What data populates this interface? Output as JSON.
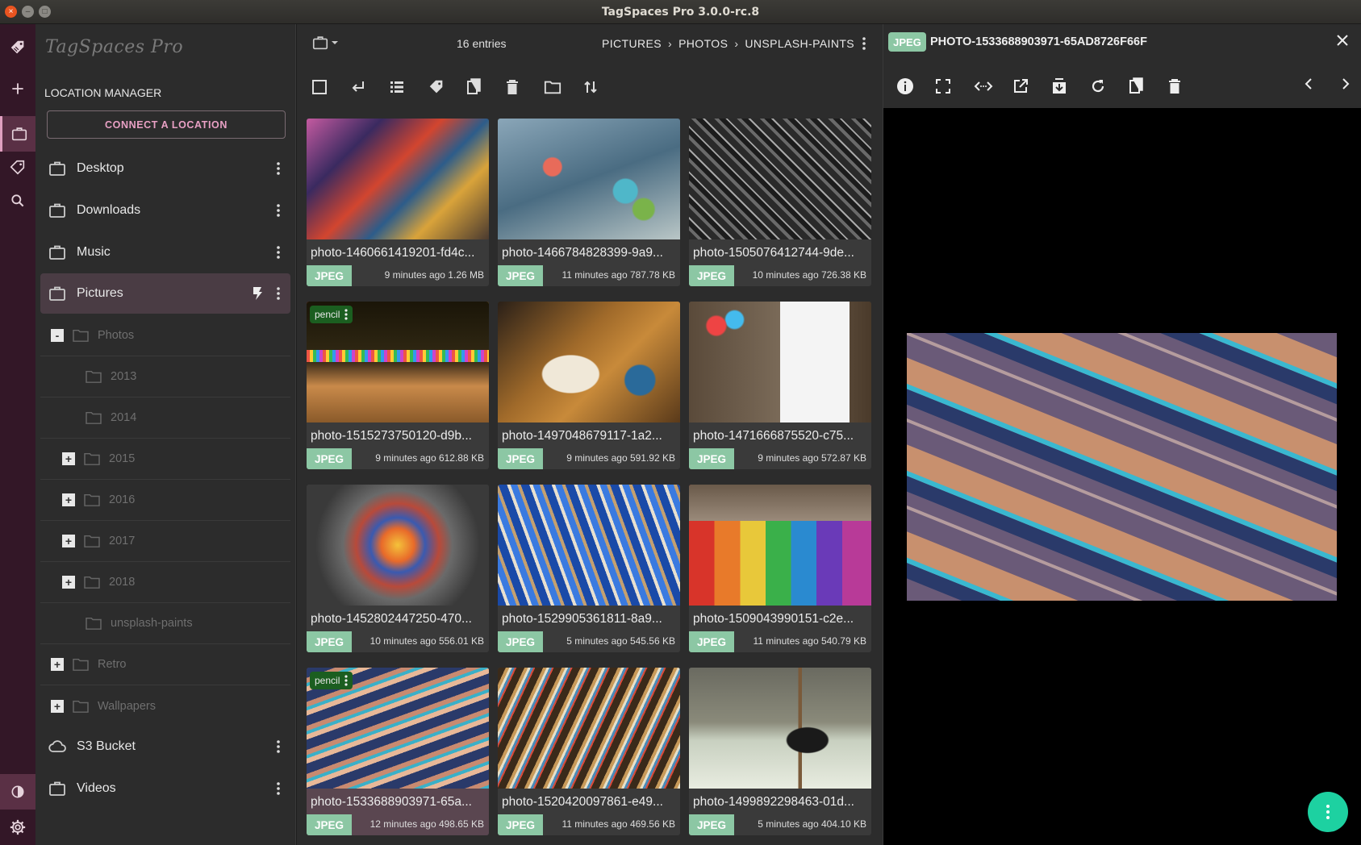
{
  "window": {
    "title": "TagSpaces Pro 3.0.0-rc.8"
  },
  "sidebar": {
    "logo": "TagSpaces Pro",
    "location_manager_title": "LOCATION MANAGER",
    "connect_label": "CONNECT A LOCATION",
    "locations": [
      {
        "label": "Desktop"
      },
      {
        "label": "Downloads"
      },
      {
        "label": "Music"
      },
      {
        "label": "Pictures"
      },
      {
        "label": "S3 Bucket"
      },
      {
        "label": "Videos"
      }
    ],
    "tree": [
      {
        "label": "Photos",
        "toggle": "-"
      },
      {
        "label": "2013",
        "toggle": ""
      },
      {
        "label": "2014",
        "toggle": ""
      },
      {
        "label": "2015",
        "toggle": "+"
      },
      {
        "label": "2016",
        "toggle": "+"
      },
      {
        "label": "2017",
        "toggle": "+"
      },
      {
        "label": "2018",
        "toggle": "+"
      },
      {
        "label": "unsplash-paints",
        "toggle": ""
      },
      {
        "label": "Retro",
        "toggle": "+"
      },
      {
        "label": "Wallpapers",
        "toggle": "+"
      }
    ]
  },
  "toolbar": {
    "entries": "16 entries",
    "breadcrumb": [
      "PICTURES",
      "PHOTOS",
      "UNSPLASH-PAINTS"
    ]
  },
  "files": [
    {
      "name": "photo-1460661419201-fd4c...",
      "ext": "JPEG",
      "meta": "9 minutes ago 1.26 MB",
      "tag": ""
    },
    {
      "name": "photo-1466784828399-9a9...",
      "ext": "JPEG",
      "meta": "11 minutes ago 787.78 KB",
      "tag": ""
    },
    {
      "name": "photo-1505076412744-9de...",
      "ext": "JPEG",
      "meta": "10 minutes ago 726.38 KB",
      "tag": ""
    },
    {
      "name": "photo-1515273750120-d9b...",
      "ext": "JPEG",
      "meta": "9 minutes ago 612.88 KB",
      "tag": "pencil"
    },
    {
      "name": "photo-1497048679117-1a2...",
      "ext": "JPEG",
      "meta": "9 minutes ago 591.92 KB",
      "tag": ""
    },
    {
      "name": "photo-1471666875520-c75...",
      "ext": "JPEG",
      "meta": "9 minutes ago 572.87 KB",
      "tag": ""
    },
    {
      "name": "photo-1452802447250-470...",
      "ext": "JPEG",
      "meta": "10 minutes ago 556.01 KB",
      "tag": ""
    },
    {
      "name": "photo-1529905361811-8a9...",
      "ext": "JPEG",
      "meta": "5 minutes ago 545.56 KB",
      "tag": ""
    },
    {
      "name": "photo-1509043990151-c2e...",
      "ext": "JPEG",
      "meta": "11 minutes ago 540.79 KB",
      "tag": ""
    },
    {
      "name": "photo-1533688903971-65a...",
      "ext": "JPEG",
      "meta": "12 minutes ago 498.65 KB",
      "tag": "pencil"
    },
    {
      "name": "photo-1520420097861-e49...",
      "ext": "JPEG",
      "meta": "11 minutes ago 469.56 KB",
      "tag": ""
    },
    {
      "name": "photo-1499892298463-01d...",
      "ext": "JPEG",
      "meta": "5 minutes ago 404.10 KB",
      "tag": ""
    }
  ],
  "viewer": {
    "ext": "JPEG",
    "filename": "PHOTO-1533688903971-65AD8726F66F"
  },
  "colors": {
    "rail": "#331727",
    "accent": "#e8a0c4",
    "jpeg_badge": "#8cc7a4",
    "tag_green": "#1b5e20",
    "fab": "#1dd1a1"
  },
  "icons": [
    "tagspaces-logo-icon",
    "plus-icon",
    "briefcase-icon",
    "tag-icon",
    "search-icon",
    "theme-icon",
    "settings-icon",
    "cloud-icon",
    "folder-icon",
    "more-vert-icon",
    "bolt-icon"
  ]
}
